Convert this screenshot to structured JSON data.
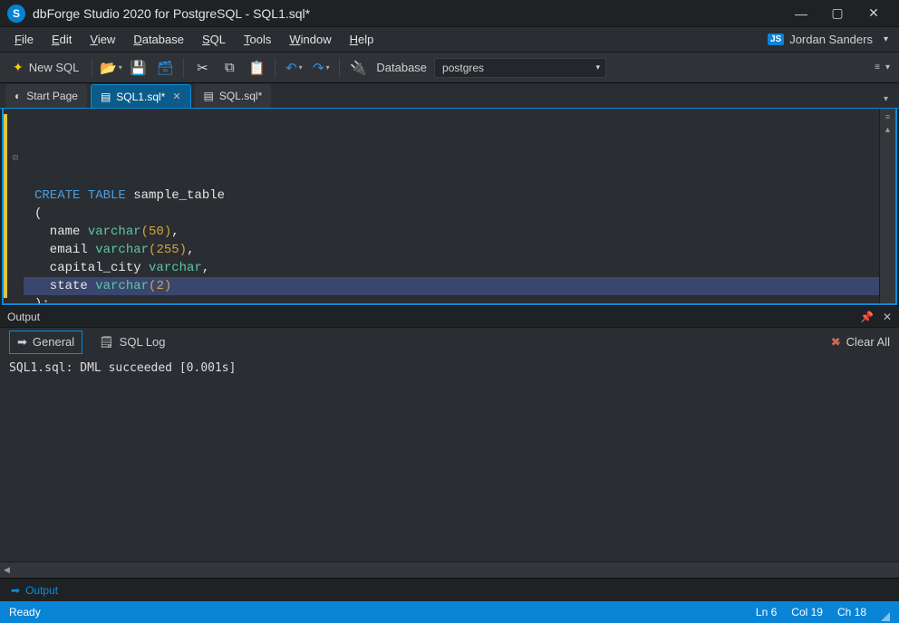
{
  "titlebar": {
    "app_icon_letter": "S",
    "title": "dbForge Studio 2020 for PostgreSQL - SQL1.sql*"
  },
  "menu": {
    "file": "File",
    "edit": "Edit",
    "view": "View",
    "database": "Database",
    "sql": "SQL",
    "tools": "Tools",
    "window": "Window",
    "help": "Help"
  },
  "user": {
    "badge": "JS",
    "name": "Jordan Sanders"
  },
  "toolbar": {
    "new_sql": "New SQL",
    "db_label": "Database",
    "db_value": "postgres"
  },
  "tabs": [
    {
      "label": "Start Page",
      "icon": "◔"
    },
    {
      "label": "SQL1.sql*",
      "icon": "▤"
    },
    {
      "label": "SQL.sql*",
      "icon": "▤"
    }
  ],
  "code": {
    "tokens": [
      [
        {
          "t": "CREATE",
          "c": "kw"
        },
        {
          "t": " ",
          "c": ""
        },
        {
          "t": "TABLE",
          "c": "kw"
        },
        {
          "t": " ",
          "c": ""
        },
        {
          "t": "sample_table",
          "c": "ident"
        }
      ],
      [
        {
          "t": "(",
          "c": "ident"
        }
      ],
      [
        {
          "t": "  name ",
          "c": "ident"
        },
        {
          "t": "varchar",
          "c": "type"
        },
        {
          "t": "(",
          "c": "paren"
        },
        {
          "t": "50",
          "c": "num"
        },
        {
          "t": ")",
          "c": "paren"
        },
        {
          "t": ",",
          "c": "ident"
        }
      ],
      [
        {
          "t": "  email ",
          "c": "ident"
        },
        {
          "t": "varchar",
          "c": "type"
        },
        {
          "t": "(",
          "c": "paren"
        },
        {
          "t": "255",
          "c": "num"
        },
        {
          "t": ")",
          "c": "paren"
        },
        {
          "t": ",",
          "c": "ident"
        }
      ],
      [
        {
          "t": "  capital_city ",
          "c": "ident"
        },
        {
          "t": "varchar",
          "c": "type"
        },
        {
          "t": ",",
          "c": "ident"
        }
      ],
      [
        {
          "t": "  state ",
          "c": "ident"
        },
        {
          "t": "varchar",
          "c": "type"
        },
        {
          "t": "(",
          "c": "paren"
        },
        {
          "t": "2",
          "c": "num"
        },
        {
          "t": ")",
          "c": "paren"
        }
      ],
      [
        {
          "t": ");",
          "c": "ident"
        }
      ]
    ],
    "selected_line_index": 5
  },
  "output": {
    "panel_title": "Output",
    "tabs": {
      "general": "General",
      "sql_log": "SQL Log"
    },
    "clear_all": "Clear All",
    "message": "SQL1.sql: DML succeeded [0.001s]"
  },
  "dock": {
    "output": "Output"
  },
  "status": {
    "ready": "Ready",
    "ln": "Ln 6",
    "col": "Col 19",
    "ch": "Ch 18"
  }
}
